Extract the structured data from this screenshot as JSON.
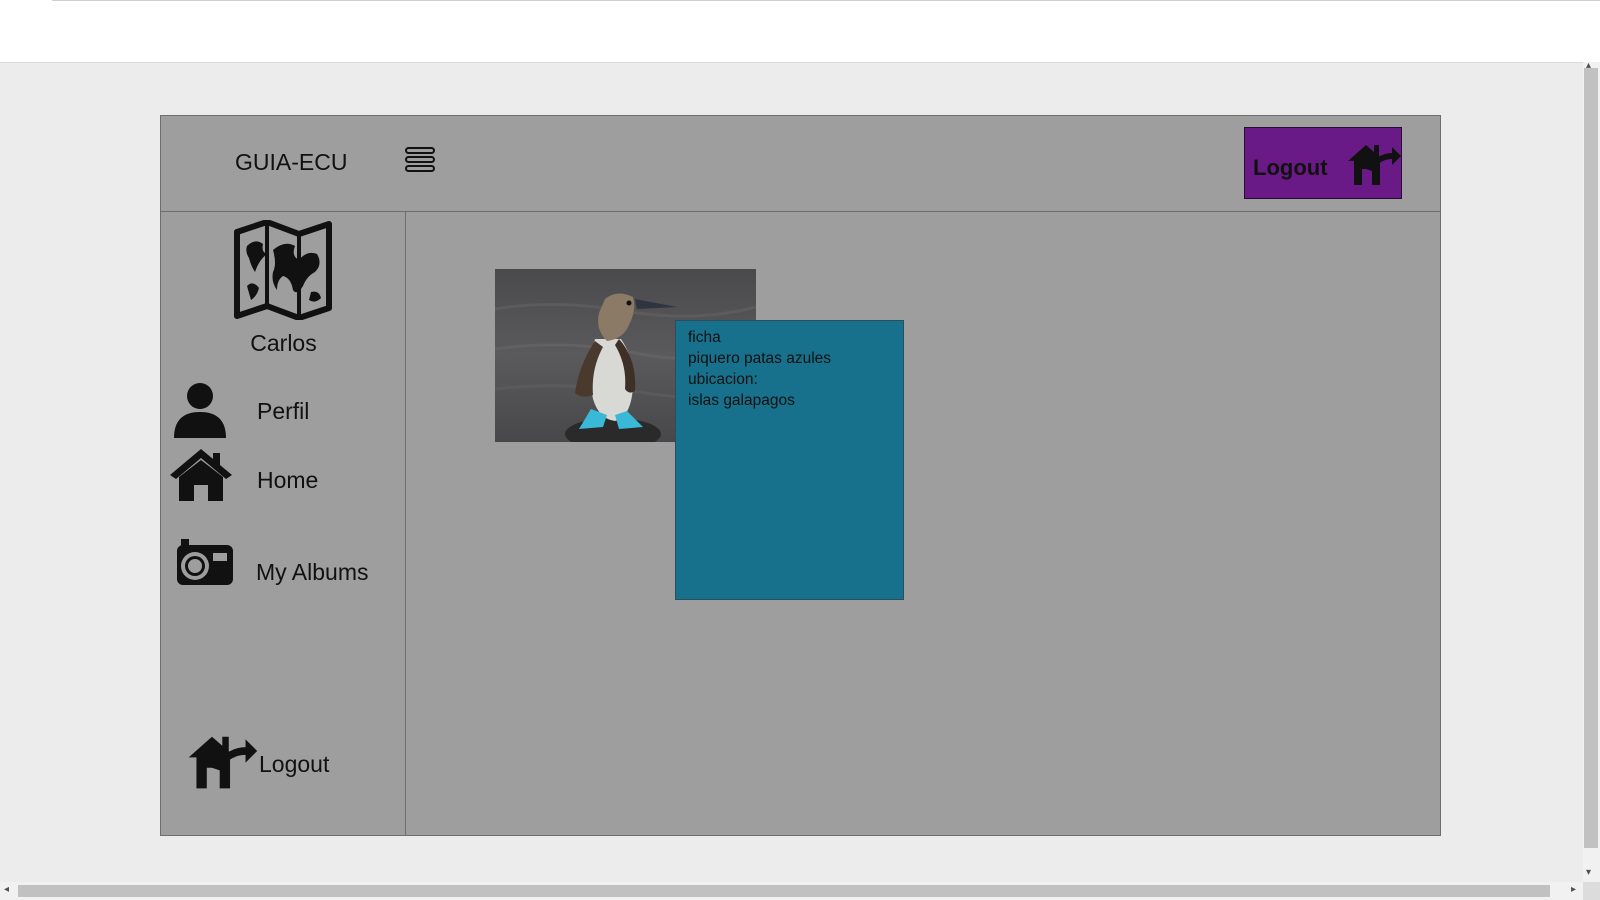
{
  "header": {
    "brand": "GUIA-ECU",
    "menu_icon": "hamburger-menu-icon",
    "logout_label": "Logout",
    "logout_icon": "house-exit-icon",
    "logout_color": "#6a1a86"
  },
  "sidebar": {
    "logo_icon": "world-map-icon",
    "username": "Carlos",
    "items": [
      {
        "label": "Perfil",
        "icon": "user-icon"
      },
      {
        "label": "Home",
        "icon": "home-icon"
      },
      {
        "label": "My Albums",
        "icon": "camera-icon"
      }
    ],
    "logout": {
      "label": "Logout",
      "icon": "house-exit-icon"
    }
  },
  "main": {
    "photo_subject": "blue-footed booby",
    "card": {
      "color": "#17718c",
      "lines": [
        "ficha",
        "piquero patas azules",
        "ubicacion:",
        "islas galapagos"
      ]
    }
  },
  "colors": {
    "frame_bg": "#9e9e9e",
    "page_bg": "#ececec"
  }
}
